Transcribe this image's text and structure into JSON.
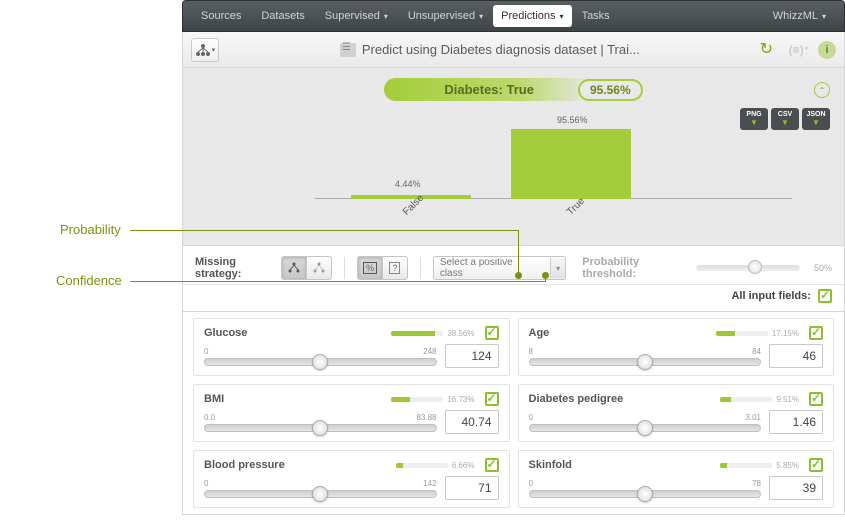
{
  "nav": {
    "items": [
      "Sources",
      "Datasets",
      "Supervised",
      "Unsupervised",
      "Predictions",
      "Tasks"
    ],
    "dropdown": [
      false,
      false,
      true,
      true,
      true,
      false
    ],
    "active": 4,
    "right": "WhizzML"
  },
  "toolbar": {
    "title": "Predict using Diabetes diagnosis dataset | Trai...",
    "eq": "(≡)⁺"
  },
  "prediction": {
    "label": "Diabetes: True",
    "pct": "95.56%"
  },
  "chart_data": {
    "type": "bar",
    "title": "",
    "xlabel": "",
    "ylabel": "",
    "ylim": [
      0,
      100
    ],
    "categories": [
      "False",
      "True"
    ],
    "values": [
      4.44,
      95.56
    ],
    "value_labels": [
      "4.44%",
      "95.56%"
    ]
  },
  "exports": [
    "PNG",
    "CSV",
    "JSON"
  ],
  "controls": {
    "missing_label": "Missing strategy:",
    "select_placeholder": "Select a positive class",
    "threshold_label": "Probability threshold:",
    "threshold_value": "50%",
    "all_inputs_label": "All input fields:"
  },
  "annotations": {
    "probability": "Probability",
    "confidence": "Confidence"
  },
  "fields": [
    {
      "name": "Glucose",
      "imp": "38.56%",
      "imp_fill": 38.56,
      "min": "0",
      "max": "248",
      "value": "124"
    },
    {
      "name": "Age",
      "imp": "17.15%",
      "imp_fill": 17.15,
      "min": "8",
      "max": "84",
      "value": "46"
    },
    {
      "name": "BMI",
      "imp": "16.73%",
      "imp_fill": 16.73,
      "min": "0.0",
      "max": "83.88",
      "value": "40.74"
    },
    {
      "name": "Diabetes pedigree",
      "imp": "9.51%",
      "imp_fill": 9.51,
      "min": "0",
      "max": "3.01",
      "value": "1.46"
    },
    {
      "name": "Blood pressure",
      "imp": "6.66%",
      "imp_fill": 6.66,
      "min": "0",
      "max": "142",
      "value": "71"
    },
    {
      "name": "Skinfold",
      "imp": "5.85%",
      "imp_fill": 5.85,
      "min": "0",
      "max": "78",
      "value": "39"
    }
  ]
}
